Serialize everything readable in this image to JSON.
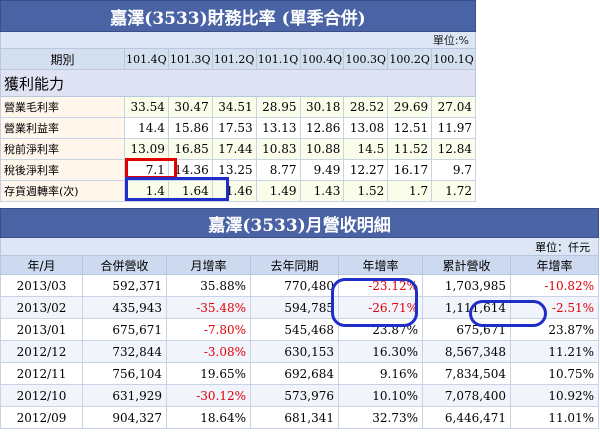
{
  "ratio_table": {
    "title": "嘉澤(3533)財務比率 (單季合併)",
    "unit": "單位:%",
    "period_label": "期別",
    "periods": [
      "101.4Q",
      "101.3Q",
      "101.2Q",
      "101.1Q",
      "100.4Q",
      "100.3Q",
      "100.2Q",
      "100.1Q"
    ],
    "section": "獲利能力",
    "rows": [
      {
        "label": "營業毛利率",
        "values": [
          "33.54",
          "30.47",
          "34.51",
          "28.95",
          "30.18",
          "28.52",
          "29.69",
          "27.04"
        ]
      },
      {
        "label": "營業利益率",
        "values": [
          "14.4",
          "15.86",
          "17.53",
          "13.13",
          "12.86",
          "13.08",
          "12.51",
          "11.97"
        ]
      },
      {
        "label": "稅前淨利率",
        "values": [
          "13.09",
          "16.85",
          "17.44",
          "10.83",
          "10.88",
          "14.5",
          "11.52",
          "12.84"
        ]
      },
      {
        "label": "稅後淨利率",
        "values": [
          "7.1",
          "14.36",
          "13.25",
          "8.77",
          "9.49",
          "12.27",
          "16.17",
          "9.7"
        ]
      },
      {
        "label": "存貨週轉率(次)",
        "values": [
          "1.4",
          "1.64",
          "1.46",
          "1.49",
          "1.43",
          "1.52",
          "1.7",
          "1.72"
        ]
      }
    ]
  },
  "revenue_table": {
    "title": "嘉澤(3533)月營收明細",
    "unit": "單位：仟元",
    "headers": [
      "年/月",
      "合併營收",
      "月增率",
      "去年同期",
      "年增率",
      "累計營收",
      "年增率"
    ],
    "rows": [
      {
        "cells": [
          "2013/03",
          "592,371",
          "35.88%",
          "770,480",
          "-23.12%",
          "1,703,985",
          "-10.82%"
        ]
      },
      {
        "cells": [
          "2013/02",
          "435,943",
          "-35.48%",
          "594,785",
          "-26.71%",
          "1,111,614",
          "-2.51%"
        ]
      },
      {
        "cells": [
          "2013/01",
          "675,671",
          "-7.80%",
          "545,468",
          "23.87%",
          "675,671",
          "23.87%"
        ]
      },
      {
        "cells": [
          "2012/12",
          "732,844",
          "-3.08%",
          "630,153",
          "16.30%",
          "8,567,348",
          "11.21%"
        ]
      },
      {
        "cells": [
          "2012/11",
          "756,104",
          "19.65%",
          "692,684",
          "9.16%",
          "7,834,504",
          "10.75%"
        ]
      },
      {
        "cells": [
          "2012/10",
          "631,929",
          "-30.12%",
          "573,976",
          "10.10%",
          "7,078,400",
          "10.92%"
        ]
      },
      {
        "cells": [
          "2012/09",
          "904,327",
          "18.64%",
          "681,341",
          "32.73%",
          "6,446,471",
          "11.01%"
        ]
      }
    ]
  },
  "colors": {
    "header_bg": "#4a63a4",
    "negative": "#e3000b",
    "highlight_red": "#e00000",
    "highlight_blue": "#1f2ec8"
  }
}
